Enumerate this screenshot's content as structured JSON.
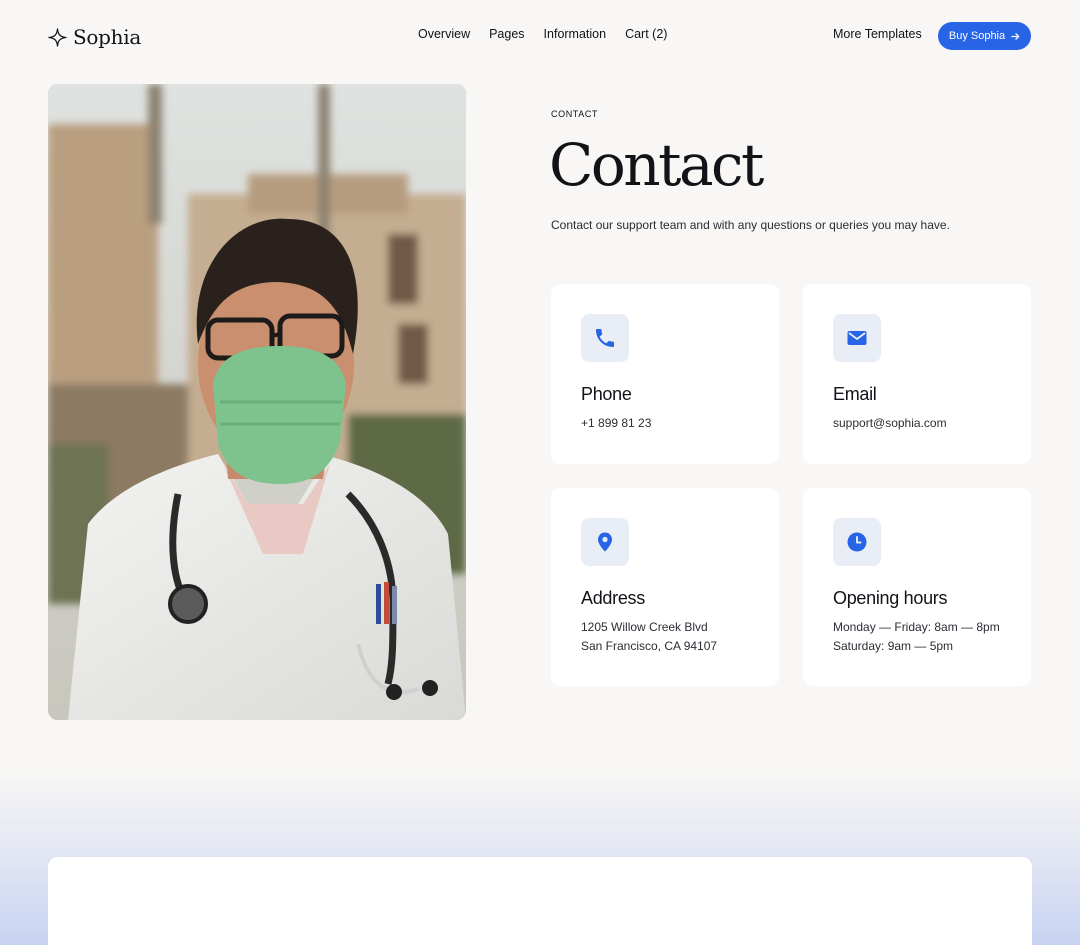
{
  "brand": {
    "name": "Sophia"
  },
  "nav": {
    "items": [
      "Overview",
      "Pages",
      "Information",
      "Cart (2)"
    ],
    "more_templates": "More Templates",
    "buy_label": "Buy Sophia"
  },
  "hero": {
    "eyebrow": "CONTACT",
    "title": "Contact",
    "subtitle": "Contact our support team and with any questions or queries you may have."
  },
  "cards": [
    {
      "icon": "phone-icon",
      "title": "Phone",
      "lines": [
        "+1 899 81 23"
      ]
    },
    {
      "icon": "mail-icon",
      "title": "Email",
      "lines": [
        "support@sophia.com"
      ]
    },
    {
      "icon": "location-pin-icon",
      "title": "Address",
      "lines": [
        "1205 Willow Creek Blvd",
        "San Francisco, CA 94107"
      ]
    },
    {
      "icon": "clock-icon",
      "title": "Opening hours",
      "lines": [
        "Monday — Friday: 8am — 8pm",
        "Saturday: 9am — 5pm"
      ]
    }
  ],
  "colors": {
    "accent": "#2864e6",
    "background": "#f8f7f5",
    "card_icon_bg": "#e9edf6"
  }
}
